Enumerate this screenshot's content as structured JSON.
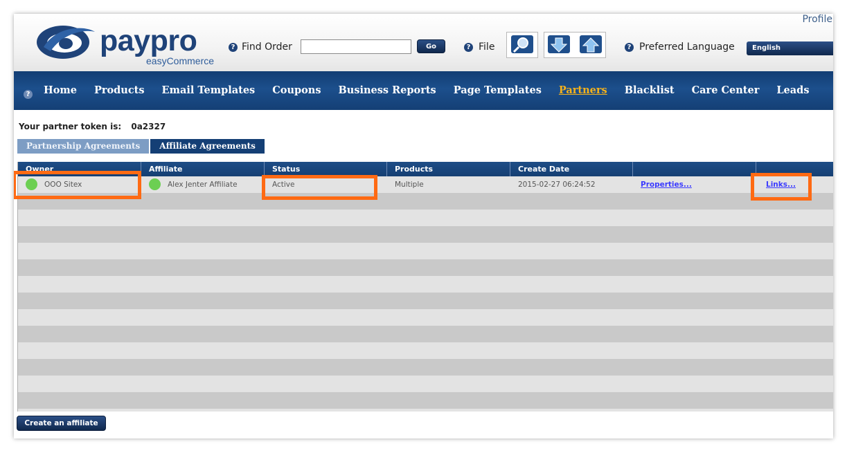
{
  "header": {
    "profile": "Profile",
    "logo_word": "paypro",
    "logo_sub": "easyCommerce",
    "find_order_label": "Find Order",
    "find_order_value": "",
    "go_label": "Go",
    "file_label": "File",
    "preferred_language_label": "Preferred Language",
    "language_value": "English",
    "icons": [
      "help-icon",
      "magnifier-icon",
      "download-icon",
      "upload-icon"
    ]
  },
  "nav": {
    "items": [
      {
        "label": "Home"
      },
      {
        "label": "Products"
      },
      {
        "label": "Email Templates"
      },
      {
        "label": "Coupons"
      },
      {
        "label": "Business Reports"
      },
      {
        "label": "Page Templates"
      },
      {
        "label": "Partners",
        "active": true
      },
      {
        "label": "Blacklist"
      },
      {
        "label": "Care Center"
      },
      {
        "label": "Leads"
      }
    ]
  },
  "content": {
    "token_label": "Your partner token is:",
    "token_value": "0a2327",
    "tabs": [
      {
        "label": "Partnership Agreements",
        "active": false
      },
      {
        "label": "Affiliate Agreements",
        "active": true
      }
    ],
    "table": {
      "columns": [
        "Owner",
        "Affiliate",
        "Status",
        "Products",
        "Create Date",
        "",
        ""
      ],
      "rows": [
        {
          "owner": "OOO Sitex",
          "affiliate": "Alex Jenter Affiliate",
          "status": "Active",
          "products": "Multiple",
          "create_date": "2015-02-27 06:24:52",
          "properties_link": "Properties...",
          "links_link": "Links..."
        }
      ]
    },
    "create_button": "Create an affiliate"
  },
  "colors": {
    "nav_bg": "#1c4f8c",
    "active_nav": "#f5b21b",
    "highlight": "#ff6a13",
    "status_green": "#6ccf52"
  }
}
